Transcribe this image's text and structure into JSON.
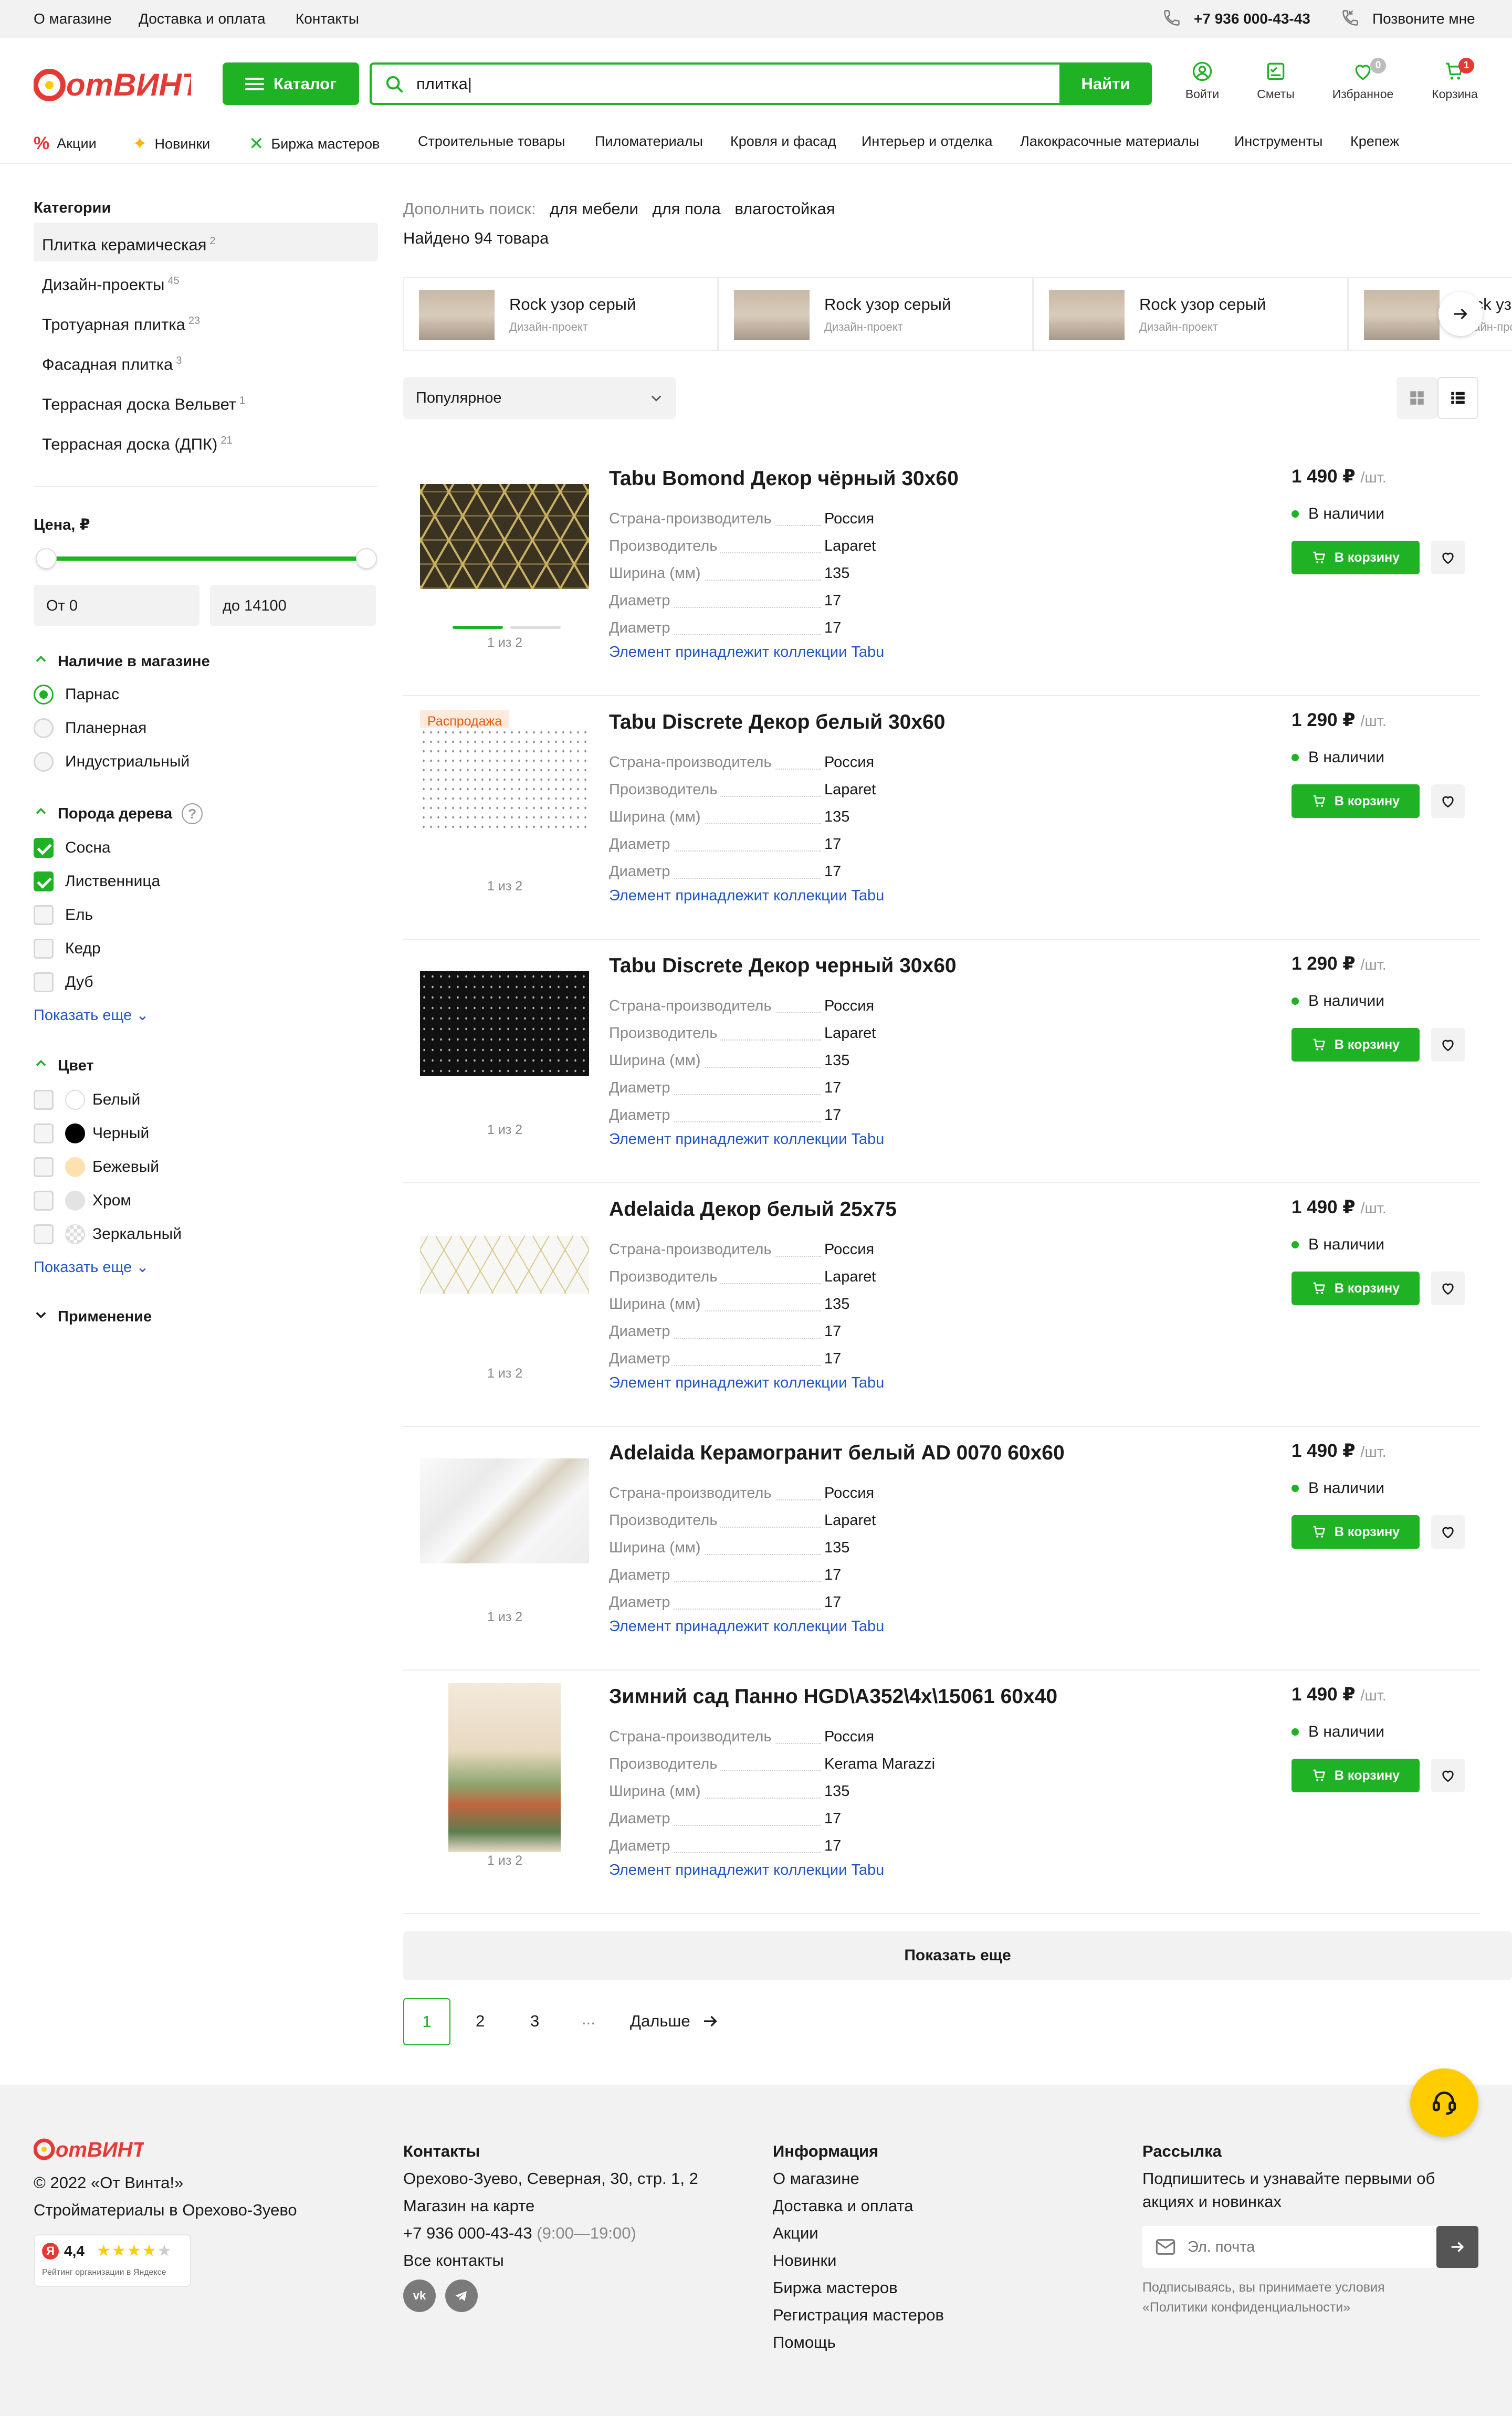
{
  "topbar": {
    "links": [
      "О магазине",
      "Доставка и оплата",
      "Контакты"
    ],
    "phone": "+7 936 000-43-43",
    "callback": "Позвоните мне"
  },
  "header": {
    "logo_text": "отВИНТА!",
    "catalog_label": "Каталог",
    "search_value": "плитка|",
    "search_button": "Найти",
    "icons": [
      {
        "name": "login",
        "label": "Войти"
      },
      {
        "name": "estimates",
        "label": "Сметы"
      },
      {
        "name": "favorites",
        "label": "Избранное",
        "badge": "0"
      },
      {
        "name": "cart",
        "label": "Корзина",
        "badge": "1"
      }
    ]
  },
  "nav": [
    "Акции",
    "Новинки",
    "Биржа мастеров",
    "Строительные товары",
    "Пиломатериалы",
    "Кровля и фасад",
    "Интерьер и отделка",
    "Лакокрасочные материалы",
    "Инструменты",
    "Крепеж"
  ],
  "sidebar": {
    "categories_title": "Категории",
    "categories": [
      {
        "label": "Плитка керамическая",
        "count": "2"
      },
      {
        "label": "Дизайн-проекты",
        "count": "45"
      },
      {
        "label": "Тротуарная плитка",
        "count": "23"
      },
      {
        "label": "Фасадная плитка",
        "count": "3"
      },
      {
        "label": "Террасная доска Вельвет",
        "count": "1"
      },
      {
        "label": "Террасная доска (ДПК)",
        "count": "21"
      }
    ],
    "price_title": "Цена, ₽",
    "price_from": "От 0",
    "price_to": "до 14100",
    "price_range": [
      0,
      14100
    ],
    "price_selected": [
      0,
      14100
    ],
    "availability_title": "Наличие в магазине",
    "availability": [
      {
        "label": "Парнас",
        "checked": true
      },
      {
        "label": "Планерная",
        "checked": false
      },
      {
        "label": "Индустриальный",
        "checked": false
      }
    ],
    "wood_title": "Порода дерева",
    "wood": [
      {
        "label": "Сосна",
        "checked": true
      },
      {
        "label": "Лиственница",
        "checked": true
      },
      {
        "label": "Ель",
        "checked": false
      },
      {
        "label": "Кедр",
        "checked": false
      },
      {
        "label": "Дуб",
        "checked": false
      }
    ],
    "show_more": "Показать еще",
    "color_title": "Цвет",
    "colors": [
      {
        "label": "Белый",
        "hex": "#ffffff"
      },
      {
        "label": "Черный",
        "hex": "#000000"
      },
      {
        "label": "Бежевый",
        "hex": "#fde2b0"
      },
      {
        "label": "Хром",
        "hex": "#e3e3e3"
      },
      {
        "label": "Зеркальный",
        "hex": "#cccccc"
      }
    ],
    "application_title": "Применение"
  },
  "main": {
    "refine_label": "Дополнить поиск:",
    "refine_chips": [
      "для мебели",
      "для пола",
      "влагостойкая"
    ],
    "found": "Найдено 94 товара",
    "design_projects": [
      {
        "title": "Rock узор серый",
        "subtitle": "Дизайн-проект"
      },
      {
        "title": "Rock узор серый",
        "subtitle": "Дизайн-проект"
      },
      {
        "title": "Rock узор серый",
        "subtitle": "Дизайн-проект"
      },
      {
        "title": "Rock узор серый",
        "subtitle": "Дизайн-проект"
      }
    ],
    "sort_label": "Популярное",
    "spec_labels": [
      "Страна-производитель",
      "Производитель",
      "Ширина (мм)",
      "Диаметр",
      "Диаметр"
    ],
    "unit": "/шт.",
    "stock": "В наличии",
    "cart_label": "В корзину",
    "collection_label": "Элемент принадлежит коллекции Tabu",
    "products": [
      {
        "name": "Tabu Bomond Декор чёрный 30x60",
        "price": "1 490 ₽",
        "counter": "1 из 2",
        "specs": [
          "Россия",
          "Laparet",
          "135",
          "17",
          "17"
        ],
        "sale": ""
      },
      {
        "name": "Tabu Discrete Декор белый 30x60",
        "price": "1 290 ₽",
        "counter": "1 из 2",
        "specs": [
          "Россия",
          "Laparet",
          "135",
          "17",
          "17"
        ],
        "sale": "Распродажа"
      },
      {
        "name": "Tabu Discrete Декор черный 30x60",
        "price": "1 290 ₽",
        "counter": "1 из 2",
        "specs": [
          "Россия",
          "Laparet",
          "135",
          "17",
          "17"
        ],
        "sale": ""
      },
      {
        "name": "Adelaida Декор белый 25x75",
        "price": "1 490 ₽",
        "counter": "1 из 2",
        "specs": [
          "Россия",
          "Laparet",
          "135",
          "17",
          "17"
        ],
        "sale": ""
      },
      {
        "name": "Adelaida Керамогранит белый AD 0070 60x60",
        "price": "1 490 ₽",
        "counter": "1 из 2",
        "specs": [
          "Россия",
          "Laparet",
          "135",
          "17",
          "17"
        ],
        "sale": ""
      },
      {
        "name": "Зимний сад Панно HGD\\A352\\4x\\15061 60x40",
        "price": "1 490 ₽",
        "counter": "1 из 2",
        "specs": [
          "Россия",
          "Kerama Marazzi",
          "135",
          "17",
          "17"
        ],
        "sale": ""
      }
    ],
    "show_more": "Показать еще",
    "pagination": {
      "pages": [
        "1",
        "2",
        "3",
        "..."
      ],
      "next": "Дальше"
    }
  },
  "footer": {
    "logo_text": "отВИНТА!",
    "copyright": "© 2022 «От Винта!»",
    "tagline": "Стройматериалы в Орехово-Зуево",
    "rating": "4,4",
    "rating_caption": "Рейтинг организации в Яндексе",
    "contacts_title": "Контакты",
    "address": "Орехово-Зуево, Северная, 30, стр. 1, 2",
    "map_link": "Магазин на карте",
    "phone": "+7 936 000-43-43",
    "hours": "(9:00—19:00)",
    "all_contacts": "Все контакты",
    "info_title": "Информация",
    "info_links": [
      "О магазине",
      "Доставка и оплата",
      "Акции",
      "Новинки",
      "Биржа мастеров",
      "Регистрация мастеров",
      "Помощь"
    ],
    "newsletter_title": "Рассылка",
    "newsletter_text1": "Подпишитесь и узнавайте первыми об",
    "newsletter_text2": "акциях и новинках",
    "email_placeholder": "Эл. почта",
    "consent1": "Подписываясь, вы принимаете условия",
    "consent2": "«Политики конфиденциальности»"
  },
  "colors": {
    "accent": "#1eb224",
    "link": "#2154c2",
    "badge_red": "#e53935",
    "badge_grey": "#bdbdbd",
    "help_yellow": "#ffcc00"
  }
}
